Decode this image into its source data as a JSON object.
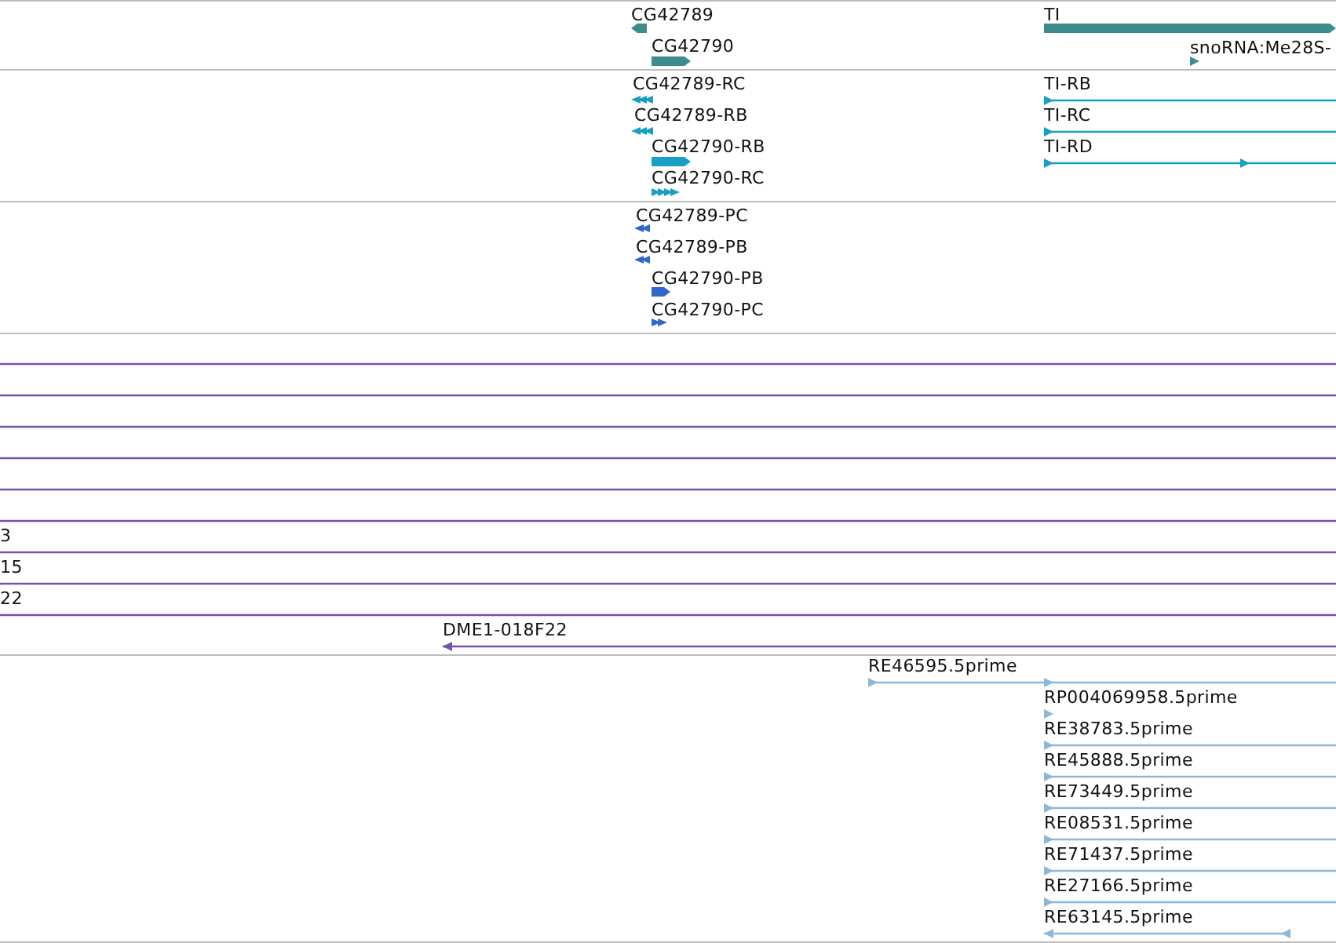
{
  "tracks": [
    {
      "kind": "gene",
      "features": [
        {
          "label": "CG42789",
          "reverse": true,
          "kind": "block"
        },
        {
          "label": "CG42790",
          "reverse": false,
          "kind": "block"
        },
        {
          "label": "TI",
          "reverse": false,
          "kind": "block"
        },
        {
          "label": "snoRNA:Me28S-",
          "reverse": false,
          "kind": "line"
        }
      ]
    },
    {
      "kind": "transcript",
      "features": [
        {
          "label": "CG42789-RC",
          "reverse": true,
          "kind": "chevrons"
        },
        {
          "label": "CG42789-RB",
          "reverse": true,
          "kind": "chevrons"
        },
        {
          "label": "CG42790-RB",
          "reverse": false,
          "kind": "block"
        },
        {
          "label": "CG42790-RC",
          "reverse": false,
          "kind": "chevrons"
        },
        {
          "label": "TI-RB",
          "reverse": false,
          "kind": "line"
        },
        {
          "label": "TI-RC",
          "reverse": false,
          "kind": "line"
        },
        {
          "label": "TI-RD",
          "reverse": false,
          "kind": "line"
        }
      ]
    },
    {
      "kind": "protein",
      "features": [
        {
          "label": "CG42789-PC",
          "reverse": true,
          "kind": "chevrons"
        },
        {
          "label": "CG42789-PB",
          "reverse": true,
          "kind": "chevrons"
        },
        {
          "label": "CG42790-PB",
          "reverse": false,
          "kind": "block"
        },
        {
          "label": "CG42790-PC",
          "reverse": false,
          "kind": "chevrons"
        }
      ]
    },
    {
      "kind": "clone",
      "features": [
        {
          "kind": "line"
        },
        {
          "kind": "line"
        },
        {
          "kind": "line"
        },
        {
          "kind": "line"
        },
        {
          "kind": "line"
        },
        {
          "kind": "line"
        },
        {
          "label": "3",
          "kind": "line"
        },
        {
          "label": "15",
          "kind": "line"
        },
        {
          "label": "22",
          "kind": "line"
        },
        {
          "label": "DME1-018F22",
          "reverse": true,
          "kind": "line"
        }
      ]
    },
    {
      "kind": "est",
      "features": [
        {
          "label": "RE46595.5prime",
          "reverse": false,
          "kind": "line"
        },
        {
          "label": "RP004069958.5prime",
          "reverse": false,
          "kind": "line"
        },
        {
          "label": "RE38783.5prime",
          "reverse": false,
          "kind": "line"
        },
        {
          "label": "RE45888.5prime",
          "reverse": false,
          "kind": "line"
        },
        {
          "label": "RE73449.5prime",
          "reverse": false,
          "kind": "line"
        },
        {
          "label": "RE08531.5prime",
          "reverse": false,
          "kind": "line"
        },
        {
          "label": "RE71437.5prime",
          "reverse": false,
          "kind": "line"
        },
        {
          "label": "RE27166.5prime",
          "reverse": false,
          "kind": "line"
        },
        {
          "label": "RE63145.5prime",
          "reverse": true,
          "kind": "line"
        }
      ]
    }
  ]
}
